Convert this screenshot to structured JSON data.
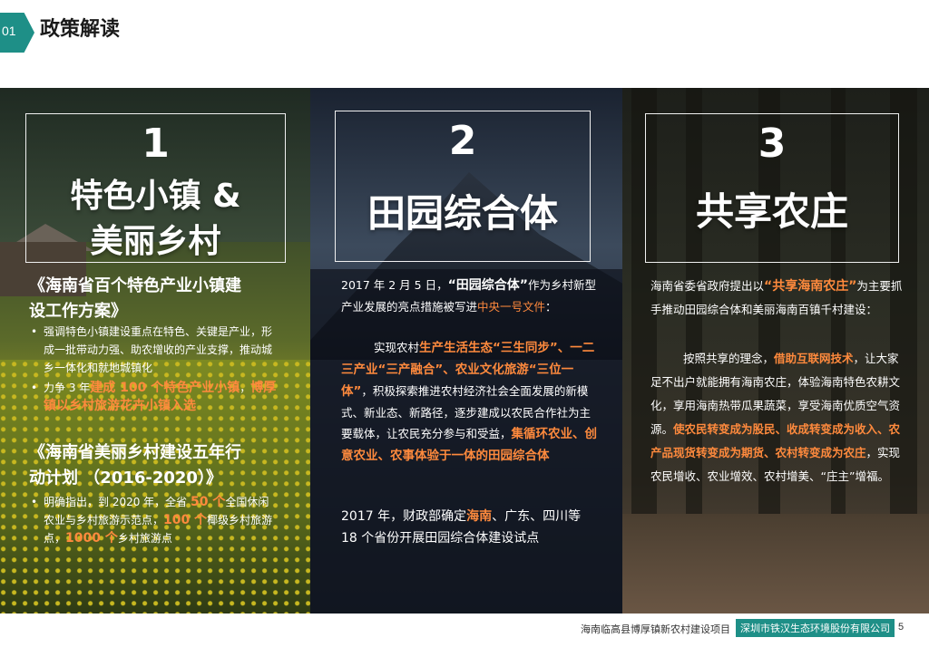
{
  "header": {
    "number": "01",
    "title": "政策解读"
  },
  "panels": [
    {
      "number": "1",
      "title_lines": [
        "特色小镇 &",
        "美丽乡村"
      ],
      "sections": [
        {
          "heading_lines": [
            "《海南省百个特色产业小镇建",
            "设工作方案》"
          ],
          "bullets": [
            {
              "parts": [
                {
                  "t": "强调特色小镇建设重点在特色、关键是产业，形成一批带动力强、助农增收的产业支撑，推动城乡一体化和就地城镇化"
                }
              ]
            },
            {
              "parts": [
                {
                  "t": "力争 3 年"
                },
                {
                  "t": "建成 100 个特色产业小镇",
                  "hl": true
                },
                {
                  "t": "，"
                },
                {
                  "t": "博厚镇以乡村旅游花卉小镇入选",
                  "hl": true
                }
              ]
            }
          ]
        },
        {
          "heading_lines": [
            "《海南省美丽乡村建设五年行",
            "动计划 （2016-2020）》"
          ],
          "bullets": [
            {
              "parts": [
                {
                  "t": "明确指出，到 2020 年，全省 "
                },
                {
                  "t": "50 个",
                  "hl": true
                },
                {
                  "t": "全国休闲农业与乡村旅游示范点，"
                },
                {
                  "t": "100 个",
                  "hl": true
                },
                {
                  "t": "椰级乡村旅游点，"
                },
                {
                  "t": "1000 个",
                  "hl": true
                },
                {
                  "t": "乡村旅游点"
                }
              ]
            }
          ]
        }
      ]
    },
    {
      "number": "2",
      "title": "田园综合体",
      "para1_parts": [
        {
          "t": "2017 年 2 月 5 日，"
        },
        {
          "t": "“田园综合体”",
          "bold": true
        },
        {
          "t": "作为乡村新型产业发展的亮点措施被写进"
        },
        {
          "t": "中央一号文件",
          "orange": true
        },
        {
          "t": "："
        }
      ],
      "para2_parts": [
        {
          "t": "实现农村"
        },
        {
          "t": "生产生活生态“三生同步”、一二三产业“三产融合”、农业文化旅游“三位一体”",
          "hl": true
        },
        {
          "t": "，积极探索推进农村经济社会全面发展的新模式、新业态、新路径，逐步建成以农民合作社为主要载体，让农民充分参与和受益，"
        },
        {
          "t": "集循环农业、创意农业、农事体验于一体的田园综合体",
          "hl": true
        }
      ],
      "para3_parts": [
        {
          "t": "2017 年，财政部确定"
        },
        {
          "t": "海南",
          "orange": true
        },
        {
          "t": "、广东、四川等 18 个省份开展田园综合体建设试点"
        }
      ]
    },
    {
      "number": "3",
      "title": "共享农庄",
      "para1_parts": [
        {
          "t": "海南省委省政府提出以"
        },
        {
          "t": "“共享海南农庄”",
          "hl": true
        },
        {
          "t": "为主要抓手推动田园综合体和美丽海南百镇千村建设："
        }
      ],
      "para2_parts": [
        {
          "t": "按照共享的理念，"
        },
        {
          "t": "借助互联网技术",
          "hl": true
        },
        {
          "t": "，让大家足不出户就能拥有海南农庄，体验海南特色农耕文化，享用海南热带瓜果蔬菜，享受海南优质空气资源。"
        },
        {
          "t": "使农民转变成为股民、收成转变成为收入、农产品现货转变成为期货、农村转变成为农庄",
          "hl": true
        },
        {
          "t": "，实现农民增收、农业增效、农村增美、“庄主”增福。"
        }
      ]
    }
  ],
  "footer": {
    "project": "海南临高县博厚镇新农村建设项目",
    "company": "深圳市铁汉生态环境股份有限公司",
    "page": "5"
  },
  "colors": {
    "accent": "#1e8f87",
    "highlight": "#ff8a3d"
  }
}
